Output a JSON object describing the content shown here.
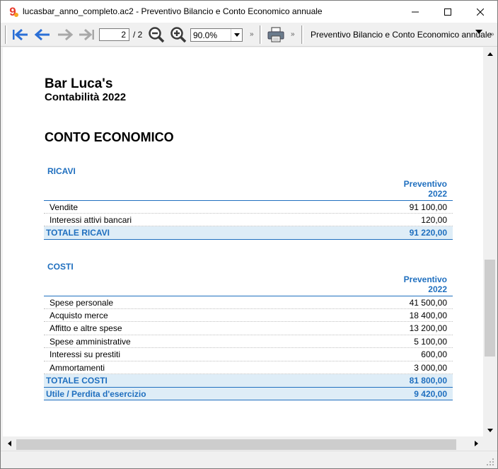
{
  "window": {
    "title": "lucasbar_anno_completo.ac2 - Preventivo Bilancio e Conto Economico annuale"
  },
  "toolbar": {
    "page_current": "2",
    "page_total": "/ 2",
    "zoom": "90.0%",
    "more": "»",
    "report_selected": "Preventivo Bilancio e Conto Economico annuale"
  },
  "report": {
    "company": "Bar Luca's",
    "subtitle": "Contabilità 2022",
    "title": "CONTO ECONOMICO",
    "ricavi": {
      "section_label": "RICAVI",
      "col_head_1": "Preventivo",
      "col_head_2": "2022",
      "rows": [
        {
          "label": "Vendite",
          "value": "91 100,00"
        },
        {
          "label": "Interessi attivi bancari",
          "value": "120,00"
        }
      ],
      "total_label": "TOTALE RICAVI",
      "total_value": "91 220,00"
    },
    "costi": {
      "section_label": "COSTI",
      "col_head_1": "Preventivo",
      "col_head_2": "2022",
      "rows": [
        {
          "label": "Spese personale",
          "value": "41 500,00"
        },
        {
          "label": "Acquisto merce",
          "value": "18 400,00"
        },
        {
          "label": "Affitto e altre spese",
          "value": "13 200,00"
        },
        {
          "label": "Spese amministrative",
          "value": "5 100,00"
        },
        {
          "label": "Interessi su prestiti",
          "value": "600,00"
        },
        {
          "label": "Ammortamenti",
          "value": "3 000,00"
        }
      ],
      "total_label": "TOTALE COSTI",
      "total_value": "81 800,00"
    },
    "result_label": "Utile / Perdita d'esercizio",
    "result_value": "9 420,00"
  },
  "icons": {
    "app": "app-logo-icon",
    "first": "first-page-icon",
    "prev": "previous-page-icon",
    "next": "next-page-icon",
    "last": "last-page-icon",
    "zoom_out": "zoom-out-icon",
    "zoom_in": "zoom-in-icon",
    "print": "printer-icon"
  },
  "colors": {
    "accent": "#1f6fbf",
    "total_bg": "#deedf7",
    "nav_arrow_active": "#2b6fd6",
    "nav_arrow_disabled": "#a8a8a8",
    "app_icon_red": "#e8392b"
  }
}
